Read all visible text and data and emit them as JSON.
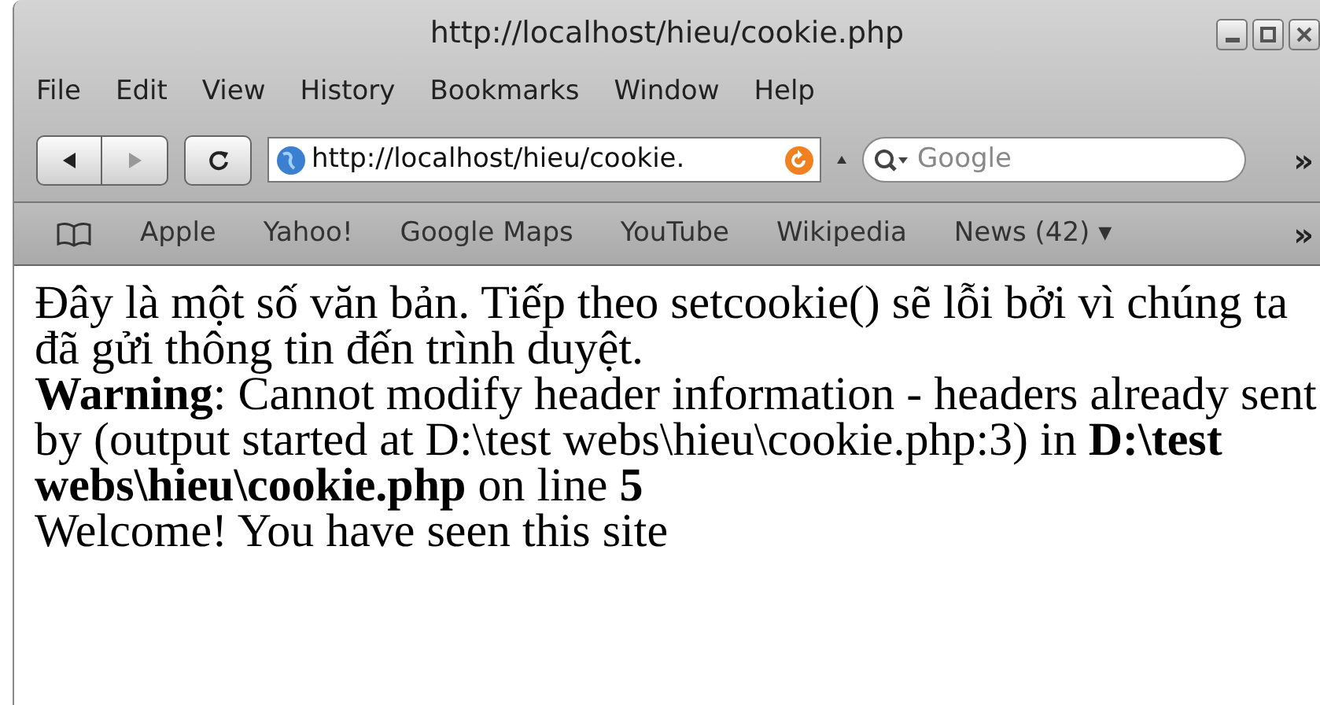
{
  "window": {
    "title": "http://localhost/hieu/cookie.php"
  },
  "menu": [
    "File",
    "Edit",
    "View",
    "History",
    "Bookmarks",
    "Window",
    "Help"
  ],
  "toolbar": {
    "address": "http://localhost/hieu/cookie.",
    "search": {
      "placeholder": "Google"
    },
    "overflow": "»"
  },
  "bookmarks": {
    "items": [
      "Apple",
      "Yahoo!",
      "Google Maps",
      "YouTube",
      "Wikipedia",
      "News (42) ▾"
    ],
    "overflow": "»"
  },
  "page": {
    "paragraphs": [
      "Đây là một số văn bản. Tiếp theo setcookie() sẽ lỗi bởi vì chúng ta đã gửi thông tin đến trình duyệt.",
      "**Warning**: Cannot modify header information - headers already sent by (output started at D:\\test webs\\hieu\\cookie.php:3) in **D:\\test webs\\hieu\\cookie.php** on line **5**",
      "Welcome! You have seen this site"
    ]
  }
}
